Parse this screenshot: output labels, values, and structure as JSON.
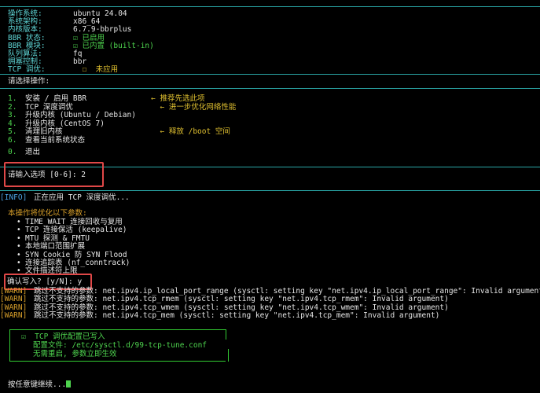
{
  "sysinfo": [
    {
      "key": "操作系统:",
      "value": "ubuntu 24.04",
      "value_color": "w"
    },
    {
      "key": "系统架构:",
      "value": "x86_64",
      "value_color": "w"
    },
    {
      "key": "内核版本:",
      "value": "6.7.9-bbrplus",
      "value_color": "w"
    },
    {
      "key": "BBR 状态:",
      "value": "☑ 已启用",
      "value_color": "g"
    },
    {
      "key": "BBR 模块:",
      "value": "☑ 已内置 (built-in)",
      "value_color": "g"
    },
    {
      "key": "队列算法:",
      "value": "fq",
      "value_color": "w"
    },
    {
      "key": "拥塞控制:",
      "value": "bbr",
      "value_color": "w"
    },
    {
      "key": "TCP 调优:",
      "value": "  ☐  未应用",
      "value_color": "y"
    }
  ],
  "menu": {
    "header": "请选择操作:",
    "items": [
      {
        "num": "1.",
        "label": "安装 / 启用 BBR",
        "note": "← 推荐先选此项"
      },
      {
        "num": "2.",
        "label": "TCP 深度调优",
        "note": "  ← 进一步优化网络性能"
      },
      {
        "num": "3.",
        "label": "升级内核 (Ubuntu / Debian)",
        "note": ""
      },
      {
        "num": "4.",
        "label": "升级内核 (CentOS 7)",
        "note": ""
      },
      {
        "num": "5.",
        "label": "清理旧内核",
        "note": "  ← 释放 /boot 空间"
      },
      {
        "num": "6.",
        "label": "查看当前系统状态",
        "note": ""
      }
    ],
    "exit": {
      "num": "0.",
      "label": "退出"
    }
  },
  "prompt_input": "请输入选项 [0-6]: 2",
  "info_tag": "[INFO]",
  "info_text": "正在应用 TCP 深度调优...",
  "optimize": {
    "header": "本操作将优化以下参数:",
    "items": [
      "TIME_WAIT 连接回收与复用",
      "TCP 连接保活 (keepalive)",
      "MTU 探测 & FMTU",
      "本地端口范围扩展",
      "SYN Cookie 防 SYN Flood",
      "连接追踪表 (nf_conntrack)",
      "文件描述符上限"
    ]
  },
  "confirm": "确认写入? [y/N]: y",
  "warnings": [
    {
      "tag": "[WARN]",
      "text": "跳过不支持的参数: net.ipv4.ip_local_port_range (sysctl: setting key \"net.ipv4.ip_local_port_range\": Invalid argument)"
    },
    {
      "tag": "[WARN]",
      "text": "跳过不支持的参数: net.ipv4.tcp_rmem (sysctl: setting key \"net.ipv4.tcp_rmem\": Invalid argument)"
    },
    {
      "tag": "[WARN]",
      "text": "跳过不支持的参数: net.ipv4.tcp_wmem (sysctl: setting key \"net.ipv4.tcp_wmem\": Invalid argument)"
    },
    {
      "tag": "[WARN]",
      "text": "跳过不支持的参数: net.ipv4.tcp_mem (sysctl: setting key \"net.ipv4.tcp_mem\": Invalid argument)"
    }
  ],
  "result_box": {
    "line1": "☑  TCP 调优配置已写入",
    "line2": "配置文件: /etc/sysctl.d/99-tcp-tune.conf",
    "line3": "无需重启, 参数立即生效"
  },
  "press_key": "按任意键继续..."
}
